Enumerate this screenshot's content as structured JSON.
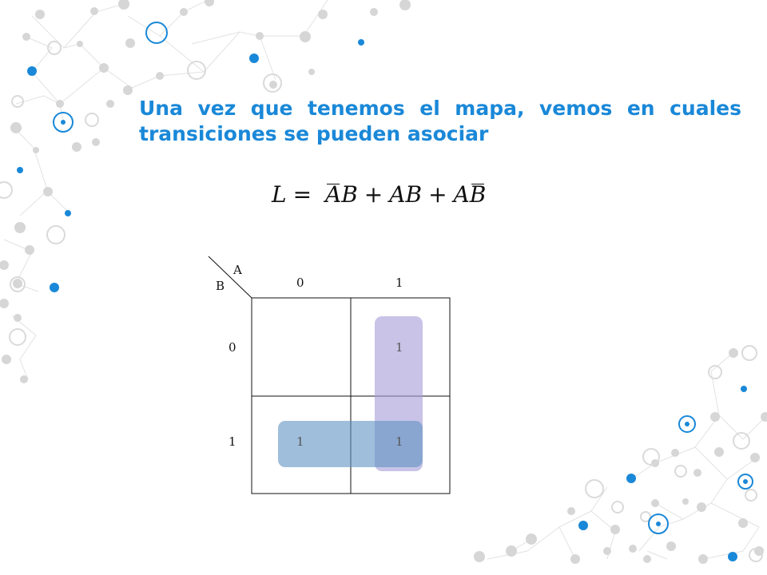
{
  "slide": {
    "heading": "Una vez que tenemos el mapa, vemos en cuales transiciones se pueden asociar"
  },
  "formula": {
    "lhs": "L",
    "eq": "=",
    "terms": [
      {
        "a": "A",
        "a_bar": true,
        "b": "B",
        "b_bar": false
      },
      {
        "a": "A",
        "a_bar": false,
        "b": "B",
        "b_bar": false
      },
      {
        "a": "A",
        "a_bar": false,
        "b": "B",
        "b_bar": true
      }
    ],
    "plus": "+"
  },
  "kmap": {
    "var_col": "A",
    "var_row": "B",
    "col_headers": [
      "0",
      "1"
    ],
    "row_headers": [
      "0",
      "1"
    ],
    "cells": [
      [
        "",
        "1"
      ],
      [
        "1",
        "1"
      ]
    ],
    "groups": [
      {
        "name": "vertical-group",
        "color": "#a79ed8"
      },
      {
        "name": "horizontal-group",
        "color": "#5f93c3"
      }
    ]
  },
  "colors": {
    "accent": "#1a88d8",
    "network_gray": "#d7d7d7"
  }
}
